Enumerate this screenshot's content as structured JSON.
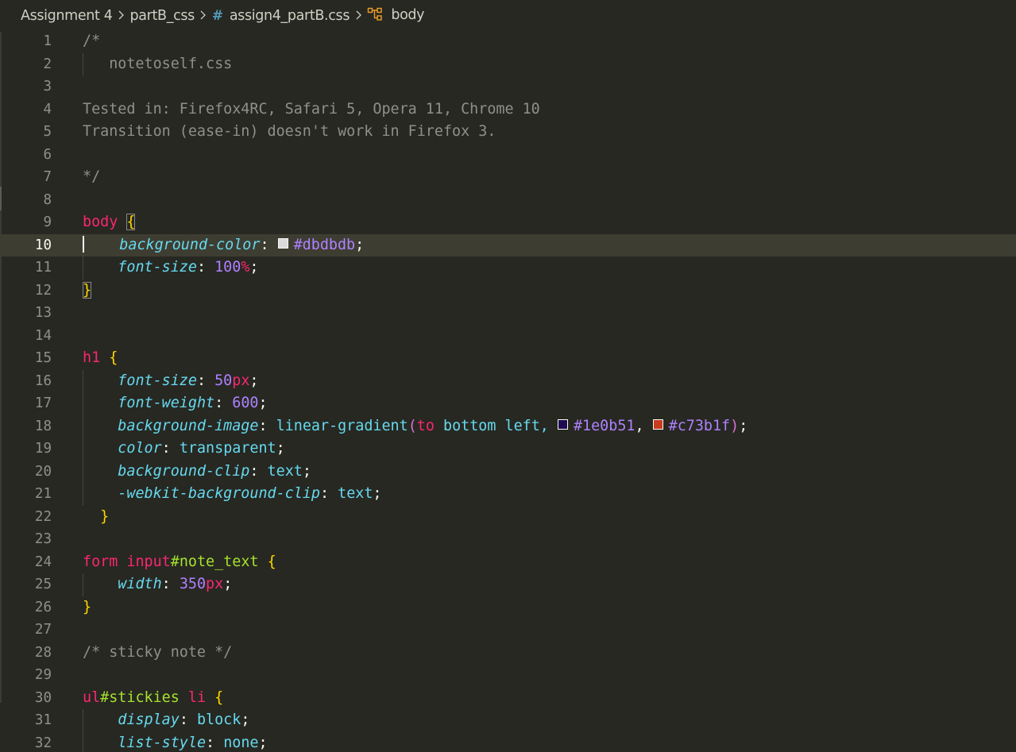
{
  "breadcrumb": {
    "folder": "Assignment 4",
    "subfolder": "partB_css",
    "file_icon": "hash-icon",
    "file_icon_glyph": "#",
    "file": "assign4_partB.css",
    "symbol_icon": "symbol-class-icon",
    "symbol": "body"
  },
  "editor": {
    "active_line": 10,
    "colors": {
      "background": "#272822",
      "line_highlight": "#3e3d32",
      "comment": "#90908a",
      "selector": "#f92672",
      "id": "#a6e22e",
      "property": "#66d9ef",
      "number": "#ae81ff",
      "brace": "#ffd700"
    },
    "lines": [
      {
        "n": "1",
        "tokens": [
          {
            "t": "/*",
            "c": "c-com"
          }
        ]
      },
      {
        "n": "2",
        "tokens": [
          {
            "t": "   notetoself.css",
            "c": "c-com"
          }
        ]
      },
      {
        "n": "3",
        "tokens": []
      },
      {
        "n": "4",
        "tokens": [
          {
            "t": "Tested in: Firefox4RC, Safari 5, Opera 11, Chrome 10",
            "c": "c-com"
          }
        ]
      },
      {
        "n": "5",
        "tokens": [
          {
            "t": "Transition (ease-in) doesn't work in Firefox 3.",
            "c": "c-com"
          }
        ]
      },
      {
        "n": "6",
        "tokens": []
      },
      {
        "n": "7",
        "tokens": [
          {
            "t": "*/",
            "c": "c-com"
          }
        ]
      },
      {
        "n": "8",
        "tokens": []
      },
      {
        "n": "9",
        "tokens": [
          {
            "t": "body",
            "c": "c-tag"
          },
          {
            "t": " ",
            "c": "c-punc"
          },
          {
            "t": "{",
            "c": "c-brace bracket-box"
          }
        ]
      },
      {
        "n": "10",
        "tokens": [
          {
            "t": "    ",
            "c": "c-punc"
          },
          {
            "t": "background-color",
            "c": "c-prop"
          },
          {
            "t": ": ",
            "c": "c-punc"
          },
          {
            "swatch": "#dbdbdb"
          },
          {
            "t": "#dbdbdb",
            "c": "c-num"
          },
          {
            "t": ";",
            "c": "c-punc"
          }
        ]
      },
      {
        "n": "11",
        "tokens": [
          {
            "t": "    ",
            "c": "c-punc"
          },
          {
            "t": "font-size",
            "c": "c-prop"
          },
          {
            "t": ": ",
            "c": "c-punc"
          },
          {
            "t": "100",
            "c": "c-num"
          },
          {
            "t": "%",
            "c": "c-unit"
          },
          {
            "t": ";",
            "c": "c-punc"
          }
        ]
      },
      {
        "n": "12",
        "tokens": [
          {
            "t": "}",
            "c": "c-brace bracket-box"
          }
        ]
      },
      {
        "n": "13",
        "tokens": []
      },
      {
        "n": "14",
        "tokens": []
      },
      {
        "n": "15",
        "tokens": [
          {
            "t": "h1",
            "c": "c-tag"
          },
          {
            "t": " ",
            "c": "c-punc"
          },
          {
            "t": "{",
            "c": "c-brace"
          }
        ]
      },
      {
        "n": "16",
        "tokens": [
          {
            "t": "    ",
            "c": "c-punc"
          },
          {
            "t": "font-size",
            "c": "c-prop"
          },
          {
            "t": ": ",
            "c": "c-punc"
          },
          {
            "t": "50",
            "c": "c-num"
          },
          {
            "t": "px",
            "c": "c-unit"
          },
          {
            "t": ";",
            "c": "c-punc"
          }
        ]
      },
      {
        "n": "17",
        "tokens": [
          {
            "t": "    ",
            "c": "c-punc"
          },
          {
            "t": "font-weight",
            "c": "c-prop"
          },
          {
            "t": ": ",
            "c": "c-punc"
          },
          {
            "t": "600",
            "c": "c-num"
          },
          {
            "t": ";",
            "c": "c-punc"
          }
        ]
      },
      {
        "n": "18",
        "tokens": [
          {
            "t": "    ",
            "c": "c-punc"
          },
          {
            "t": "background-image",
            "c": "c-prop"
          },
          {
            "t": ": ",
            "c": "c-punc"
          },
          {
            "t": "linear-gradient",
            "c": "c-val"
          },
          {
            "t": "(",
            "c": "c-paren"
          },
          {
            "t": "to",
            "c": "c-kw"
          },
          {
            "t": " bottom left, ",
            "c": "c-val"
          },
          {
            "swatch": "#1e0b51"
          },
          {
            "t": "#1e0b51",
            "c": "c-num"
          },
          {
            "t": ", ",
            "c": "c-punc"
          },
          {
            "swatch": "#c73b1f"
          },
          {
            "t": "#c73b1f",
            "c": "c-num"
          },
          {
            "t": ")",
            "c": "c-paren"
          },
          {
            "t": ";",
            "c": "c-punc"
          }
        ]
      },
      {
        "n": "19",
        "tokens": [
          {
            "t": "    ",
            "c": "c-punc"
          },
          {
            "t": "color",
            "c": "c-prop"
          },
          {
            "t": ": ",
            "c": "c-punc"
          },
          {
            "t": "transparent",
            "c": "c-val"
          },
          {
            "t": ";",
            "c": "c-punc"
          }
        ]
      },
      {
        "n": "20",
        "tokens": [
          {
            "t": "    ",
            "c": "c-punc"
          },
          {
            "t": "background-clip",
            "c": "c-prop"
          },
          {
            "t": ": ",
            "c": "c-punc"
          },
          {
            "t": "text",
            "c": "c-val"
          },
          {
            "t": ";",
            "c": "c-punc"
          }
        ]
      },
      {
        "n": "21",
        "tokens": [
          {
            "t": "    ",
            "c": "c-punc"
          },
          {
            "t": "-webkit-background-clip",
            "c": "c-prop"
          },
          {
            "t": ": ",
            "c": "c-punc"
          },
          {
            "t": "text",
            "c": "c-val"
          },
          {
            "t": ";",
            "c": "c-punc"
          }
        ]
      },
      {
        "n": "22",
        "tokens": [
          {
            "t": "  ",
            "c": "c-punc"
          },
          {
            "t": "}",
            "c": "c-brace"
          }
        ]
      },
      {
        "n": "23",
        "tokens": []
      },
      {
        "n": "24",
        "tokens": [
          {
            "t": "form",
            "c": "c-tag"
          },
          {
            "t": " ",
            "c": "c-punc"
          },
          {
            "t": "input",
            "c": "c-tag"
          },
          {
            "t": "#note_text",
            "c": "c-id"
          },
          {
            "t": " ",
            "c": "c-punc"
          },
          {
            "t": "{",
            "c": "c-brace"
          }
        ]
      },
      {
        "n": "25",
        "tokens": [
          {
            "t": "    ",
            "c": "c-punc"
          },
          {
            "t": "width",
            "c": "c-prop"
          },
          {
            "t": ": ",
            "c": "c-punc"
          },
          {
            "t": "350",
            "c": "c-num"
          },
          {
            "t": "px",
            "c": "c-unit"
          },
          {
            "t": ";",
            "c": "c-punc"
          }
        ]
      },
      {
        "n": "26",
        "tokens": [
          {
            "t": "}",
            "c": "c-brace"
          }
        ]
      },
      {
        "n": "27",
        "tokens": []
      },
      {
        "n": "28",
        "tokens": [
          {
            "t": "/* sticky note */",
            "c": "c-com"
          }
        ]
      },
      {
        "n": "29",
        "tokens": []
      },
      {
        "n": "30",
        "tokens": [
          {
            "t": "ul",
            "c": "c-tag"
          },
          {
            "t": "#stickies",
            "c": "c-id"
          },
          {
            "t": " ",
            "c": "c-punc"
          },
          {
            "t": "li",
            "c": "c-tag"
          },
          {
            "t": " ",
            "c": "c-punc"
          },
          {
            "t": "{",
            "c": "c-brace"
          }
        ]
      },
      {
        "n": "31",
        "tokens": [
          {
            "t": "    ",
            "c": "c-punc"
          },
          {
            "t": "display",
            "c": "c-prop"
          },
          {
            "t": ": ",
            "c": "c-punc"
          },
          {
            "t": "block",
            "c": "c-val"
          },
          {
            "t": ";",
            "c": "c-punc"
          }
        ]
      },
      {
        "n": "32",
        "tokens": [
          {
            "t": "    ",
            "c": "c-punc"
          },
          {
            "t": "list-style",
            "c": "c-prop"
          },
          {
            "t": ": ",
            "c": "c-punc"
          },
          {
            "t": "none",
            "c": "c-val"
          },
          {
            "t": ";",
            "c": "c-punc"
          }
        ]
      }
    ]
  }
}
